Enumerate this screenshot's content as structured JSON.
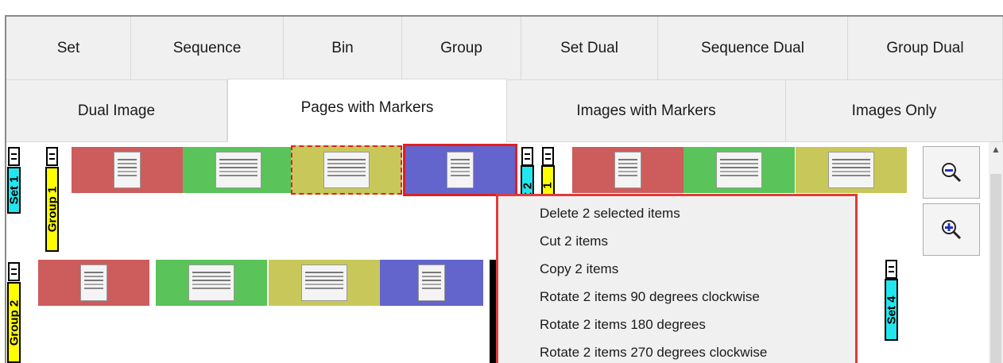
{
  "tabs_row1": [
    "Set",
    "Sequence",
    "Bin",
    "Group",
    "Set Dual",
    "Sequence Dual",
    "Group Dual"
  ],
  "tabs_row2": [
    "Dual Image",
    "Pages with Markers",
    "Images with Markers",
    "Images Only"
  ],
  "active_tab": "Pages with Markers",
  "markers": {
    "set1": "Set 1",
    "group1": "Group 1",
    "set2_partial": "t 2",
    "group_partial": "1",
    "group2": "Group 2",
    "set4": "Set 4"
  },
  "tile_colors": {
    "red": "#cd5c5c",
    "green": "#5ac35a",
    "olive": "#c8c85a",
    "blue": "#6464cd"
  },
  "zoom": {
    "zoom_out_icon": "zoom-out-icon",
    "zoom_in_icon": "zoom-in-icon"
  },
  "context_menu": {
    "border_color": "#e23a3a",
    "items": [
      "Delete 2 selected items",
      "Cut 2 items",
      "Copy 2 items",
      "Rotate 2 items 90 degrees clockwise",
      "Rotate 2 items 180 degrees",
      "Rotate 2 items 270 degrees clockwise"
    ]
  }
}
